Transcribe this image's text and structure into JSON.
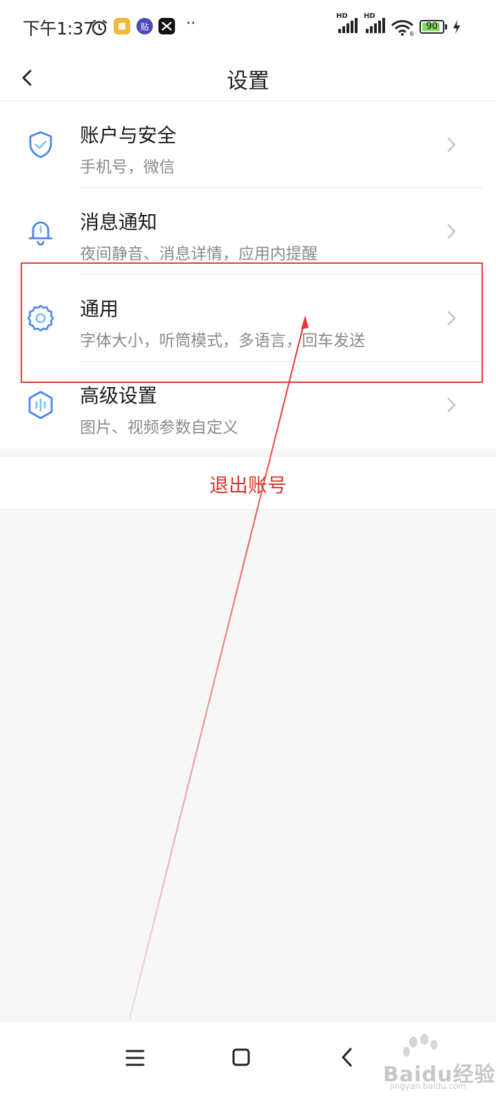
{
  "status_bar": {
    "time": "下午1:37",
    "app_icons": [
      "alarm-icon",
      "notes-app-icon",
      "tieba-app-icon",
      "capcut-app-icon"
    ],
    "more_indicator": "··",
    "signal_1_label": "HD",
    "signal_2_label": "HD",
    "battery_level": "90",
    "battery_percent": 90
  },
  "header": {
    "title": "设置"
  },
  "settings": {
    "items": [
      {
        "title": "账户与安全",
        "subtitle": "手机号，微信",
        "icon": "shield-check-icon"
      },
      {
        "title": "消息通知",
        "subtitle": "夜间静音、消息详情，应用内提醒",
        "icon": "bell-icon"
      },
      {
        "title": "通用",
        "subtitle": "字体大小，听筒模式，多语言，回车发送",
        "icon": "gear-icon"
      },
      {
        "title": "高级设置",
        "subtitle": "图片、视频参数自定义",
        "icon": "audio-wave-icon"
      }
    ]
  },
  "logout": {
    "label": "退出账号"
  },
  "watermark": {
    "brand": "Baidu经验",
    "url": "jingyan.baidu.com"
  },
  "colors": {
    "accent_blue": "#4a86e8",
    "logout_red": "#d9362b",
    "annotation_red": "#e53935",
    "background": "#f7f7f7"
  }
}
